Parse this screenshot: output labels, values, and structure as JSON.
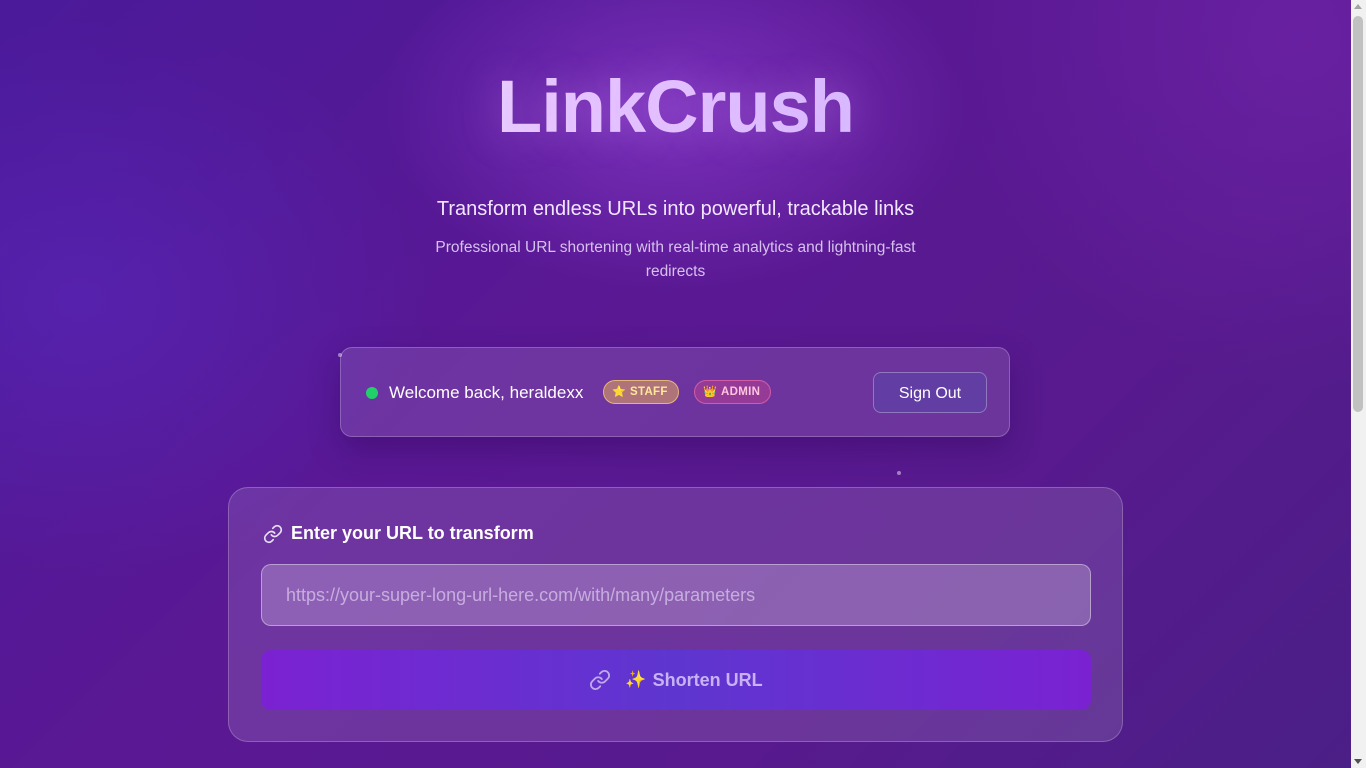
{
  "header": {
    "logo": "LinkCrush",
    "tagline": "Transform endless URLs into powerful, trackable links",
    "subtagline": "Professional URL shortening with real-time analytics and lightning-fast redirects"
  },
  "welcome": {
    "text": "Welcome back, heraldexx",
    "badges": [
      {
        "icon": "star-icon",
        "glyph": "⭐",
        "label": "STAFF"
      },
      {
        "icon": "crown-icon",
        "glyph": "👑",
        "label": "ADMIN"
      }
    ],
    "signout_label": "Sign Out",
    "status_color": "#22d06a"
  },
  "url_form": {
    "label": "Enter your URL to transform",
    "label_icon": "link-icon",
    "input_value": "",
    "input_placeholder": "https://your-super-long-url-here.com/with/many/parameters",
    "button_icon": "link-icon",
    "button_sparkle": "✨",
    "button_label": "Shorten URL"
  },
  "colors": {
    "accent": "#7b22d2",
    "button_mid": "#5e36cf",
    "background": "#581a8e"
  }
}
